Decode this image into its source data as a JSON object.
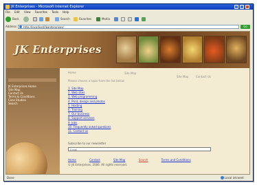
{
  "window": {
    "title": "JK Enterprises - Microsoft Internet Explorer",
    "menu": [
      "File",
      "Edit",
      "View",
      "Favorites",
      "Tools",
      "Help"
    ],
    "toolbar": {
      "back_label": "Back",
      "search_label": "Search",
      "favorites_label": "Favorites",
      "media_label": "Media"
    },
    "address": {
      "label": "Address",
      "value": "http://localhost/jkenterprises/",
      "go_label": "Go"
    },
    "status": {
      "left": "Done",
      "zone": "Local intranet"
    }
  },
  "site": {
    "logo": "JK Enterprises",
    "sidebar": {
      "heading": "",
      "items": [
        "JK Enterprises Home",
        "Site Map",
        "Contact Us",
        "Terms & Conditions",
        "Case Studies",
        "Search"
      ]
    },
    "content": {
      "breadcrumb": "Home",
      "center_title": "Site Map",
      "right_links": [
        "Site Map",
        "Contact Us"
      ],
      "intro": "Please choose a topic from the list below",
      "links": [
        "1. Site Map",
        "2. Web sites",
        "3. Web programming",
        "4. Print, design and photos",
        "5. Hosting",
        "6. Training",
        "7. Our business",
        "8. Support services",
        "9. Jobs",
        "10. Frequently asked questions",
        "11. Contact us"
      ],
      "subscribe_label": "Subscribe to our newsletter",
      "subscribe_placeholder": "Email",
      "footer_links": [
        "Home",
        "Contact",
        "Site Map",
        "Search",
        "Terms and Conditions"
      ],
      "copyright": "© JK Enterprises, 2006. All rights reserved."
    }
  },
  "colors": {
    "titlebar": "#0a3fbf",
    "page_bg": "#f4ecd2",
    "link": "#1a2fd6",
    "banner": "#9a6a38"
  }
}
